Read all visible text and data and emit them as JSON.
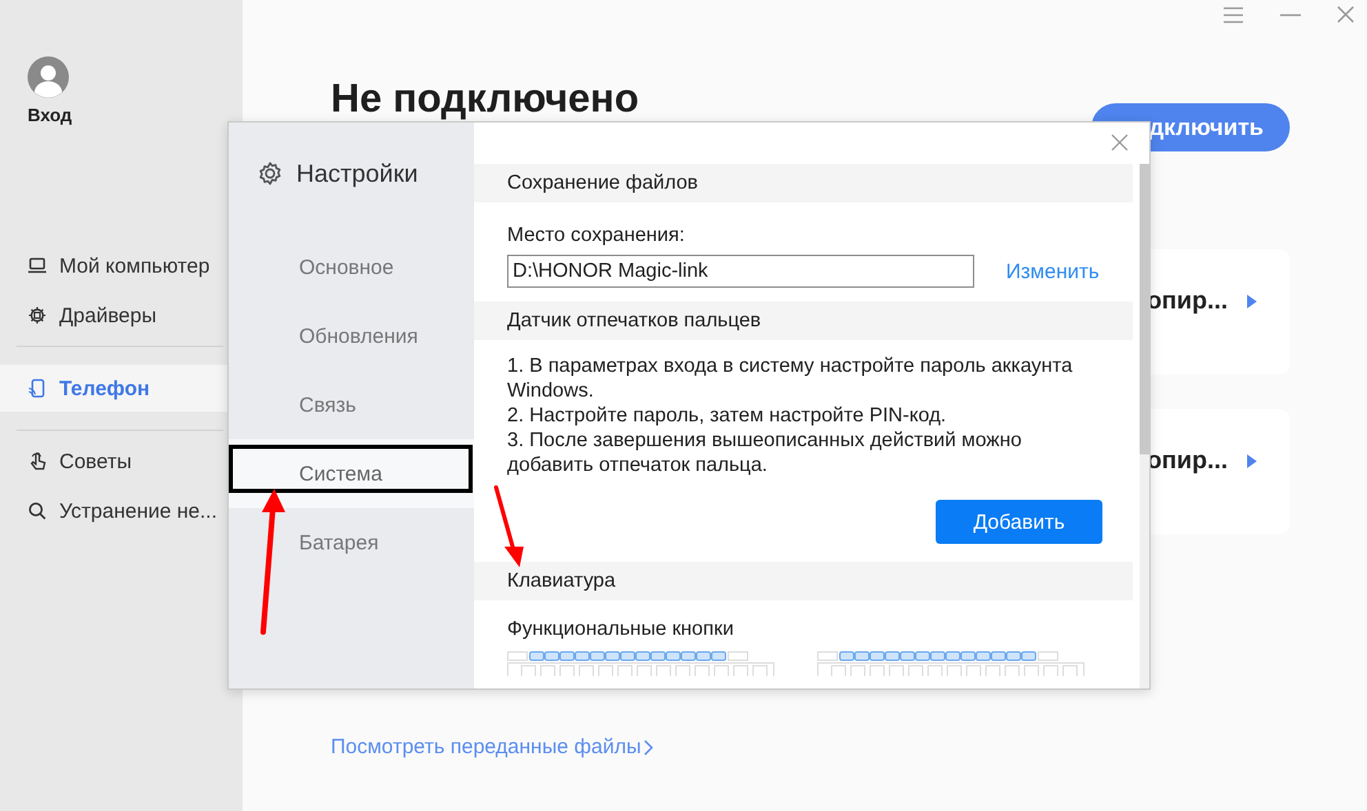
{
  "sidebar": {
    "account": {
      "label": "Вход"
    },
    "groups": [
      [
        {
          "kind": "laptop",
          "label": "Мой компьютер",
          "selected": false
        },
        {
          "kind": "chip",
          "label": "Драйверы",
          "selected": false
        }
      ],
      [
        {
          "kind": "phone",
          "label": "Телефон",
          "selected": true
        }
      ],
      [
        {
          "kind": "hand",
          "label": "Советы",
          "selected": false
        },
        {
          "kind": "search",
          "label": "Устранение не...",
          "selected": false
        }
      ]
    ]
  },
  "main": {
    "status_title": "Не подключено",
    "connect_button": "дключить",
    "cards": [
      {
        "title": "опир..."
      },
      {
        "title": "опир..."
      }
    ],
    "files_link": "Посмотреть переданные файлы"
  },
  "settings_dialog": {
    "title": "Настройки",
    "nav": [
      {
        "label": "Основное",
        "selected": false
      },
      {
        "label": "Обновления",
        "selected": false
      },
      {
        "label": "Связь",
        "selected": false
      },
      {
        "label": "Система",
        "selected": true
      },
      {
        "label": "Батарея",
        "selected": false
      }
    ],
    "file_saving": {
      "header": "Сохранение файлов",
      "label": "Место сохранения:",
      "path_value": "D:\\HONOR Magic-link",
      "change_link": "Изменить"
    },
    "fingerprint": {
      "header": "Датчик отпечатков пальцев",
      "steps": [
        "1. В параметрах входа в систему настройте пароль аккаунта Windows.",
        "2. Настройте пароль, затем настройте PIN-код.",
        "3. После завершения вышеописанных действий можно добавить отпечаток пальца."
      ],
      "add_button": "Добавить"
    },
    "keyboard": {
      "header": "Клавиатура",
      "subheader": "Функциональные кнопки"
    }
  }
}
